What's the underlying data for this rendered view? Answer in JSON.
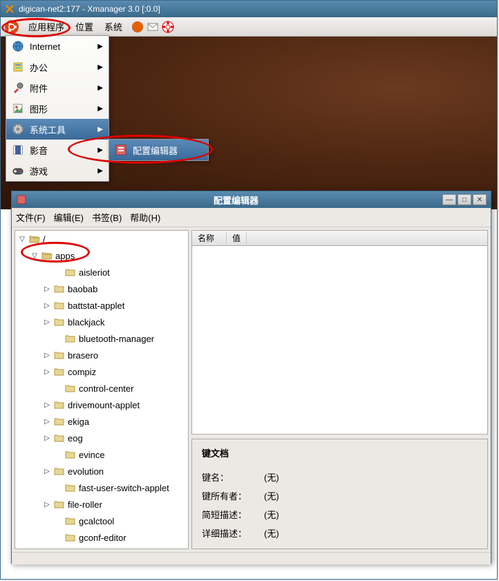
{
  "window": {
    "title": "digican-net2:177 - Xmanager 3.0 [:0.0]"
  },
  "panel": {
    "apps": "应用程序",
    "places": "位置",
    "system": "系统"
  },
  "app_menu": [
    {
      "icon": "globe",
      "label": "Internet",
      "arrow": true
    },
    {
      "icon": "office",
      "label": "办公",
      "arrow": true
    },
    {
      "icon": "accessories",
      "label": "附件",
      "arrow": true
    },
    {
      "icon": "graphics",
      "label": "图形",
      "arrow": true
    },
    {
      "icon": "system-tools",
      "label": "系统工具",
      "arrow": true,
      "selected": true
    },
    {
      "icon": "media",
      "label": "影音",
      "arrow": true
    },
    {
      "icon": "games",
      "label": "游戏",
      "arrow": true
    }
  ],
  "submenu": {
    "label": "配置编辑器"
  },
  "config": {
    "title": "配置编辑器",
    "menu": {
      "file": "文件(F)",
      "edit": "编辑(E)",
      "bookmark": "书签(B)",
      "help": "帮助(H)"
    },
    "cols": {
      "name": "名称",
      "value": "值"
    },
    "doc_title": "键文档",
    "keys": {
      "name_label": "键名：",
      "name_val": "(无)",
      "owner_label": "键所有者：",
      "owner_val": "(无)",
      "short_label": "简短描述：",
      "short_val": "(无)",
      "long_label": "详细描述：",
      "long_val": "(无)"
    },
    "tree": [
      {
        "indent": 4,
        "expander": "▽",
        "label": "/",
        "open": true
      },
      {
        "indent": 22,
        "expander": "▽",
        "label": "apps",
        "open": true
      },
      {
        "indent": 56,
        "expander": "",
        "label": "aisleriot"
      },
      {
        "indent": 40,
        "expander": "▷",
        "label": "baobab"
      },
      {
        "indent": 40,
        "expander": "▷",
        "label": "battstat-applet"
      },
      {
        "indent": 40,
        "expander": "▷",
        "label": "blackjack"
      },
      {
        "indent": 56,
        "expander": "",
        "label": "bluetooth-manager"
      },
      {
        "indent": 40,
        "expander": "▷",
        "label": "brasero"
      },
      {
        "indent": 40,
        "expander": "▷",
        "label": "compiz"
      },
      {
        "indent": 56,
        "expander": "",
        "label": "control-center"
      },
      {
        "indent": 40,
        "expander": "▷",
        "label": "drivemount-applet"
      },
      {
        "indent": 40,
        "expander": "▷",
        "label": "ekiga"
      },
      {
        "indent": 40,
        "expander": "▷",
        "label": "eog"
      },
      {
        "indent": 56,
        "expander": "",
        "label": "evince"
      },
      {
        "indent": 40,
        "expander": "▷",
        "label": "evolution"
      },
      {
        "indent": 56,
        "expander": "",
        "label": "fast-user-switch-applet"
      },
      {
        "indent": 40,
        "expander": "▷",
        "label": "file-roller"
      },
      {
        "indent": 56,
        "expander": "",
        "label": "gcalctool"
      },
      {
        "indent": 56,
        "expander": "",
        "label": "gconf-editor"
      }
    ]
  }
}
